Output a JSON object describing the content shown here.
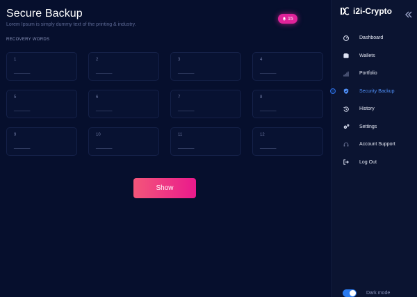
{
  "header": {
    "title": "Secure Backup",
    "subtitle": "Lorem Ipsum is simply dummy text of the printing & industry.",
    "badge_count": "15"
  },
  "recovery": {
    "label": "RECOVERY WORDS",
    "words": [
      {
        "num": "1",
        "value": "______"
      },
      {
        "num": "2",
        "value": "______"
      },
      {
        "num": "3",
        "value": "______"
      },
      {
        "num": "4",
        "value": "______"
      },
      {
        "num": "5",
        "value": "______"
      },
      {
        "num": "6",
        "value": "______"
      },
      {
        "num": "7",
        "value": "______"
      },
      {
        "num": "8",
        "value": "______"
      },
      {
        "num": "9",
        "value": "______"
      },
      {
        "num": "10",
        "value": "______"
      },
      {
        "num": "11",
        "value": "______"
      },
      {
        "num": "12",
        "value": "______"
      }
    ],
    "show_label": "Show"
  },
  "sidebar": {
    "brand": "i2i-Crypto",
    "items": [
      {
        "label": "Dashboard",
        "icon": "dashboard-icon"
      },
      {
        "label": "Wallets",
        "icon": "wallet-icon"
      },
      {
        "label": "Portfolio",
        "icon": "bar-chart-icon"
      },
      {
        "label": "Security Backup",
        "icon": "shield-icon",
        "active": true
      },
      {
        "label": "History",
        "icon": "history-icon"
      },
      {
        "label": "Settings",
        "icon": "gears-icon"
      },
      {
        "label": "Account Support",
        "icon": "headset-icon"
      },
      {
        "label": "Log Out",
        "icon": "logout-icon"
      }
    ],
    "dark_mode_label": "Dark mode",
    "dark_mode_on": true
  },
  "colors": {
    "accent": "#4f8ff7",
    "button_gradient_start": "#f3567a",
    "button_gradient_end": "#ea1a8c",
    "badge": "#e0239a"
  }
}
